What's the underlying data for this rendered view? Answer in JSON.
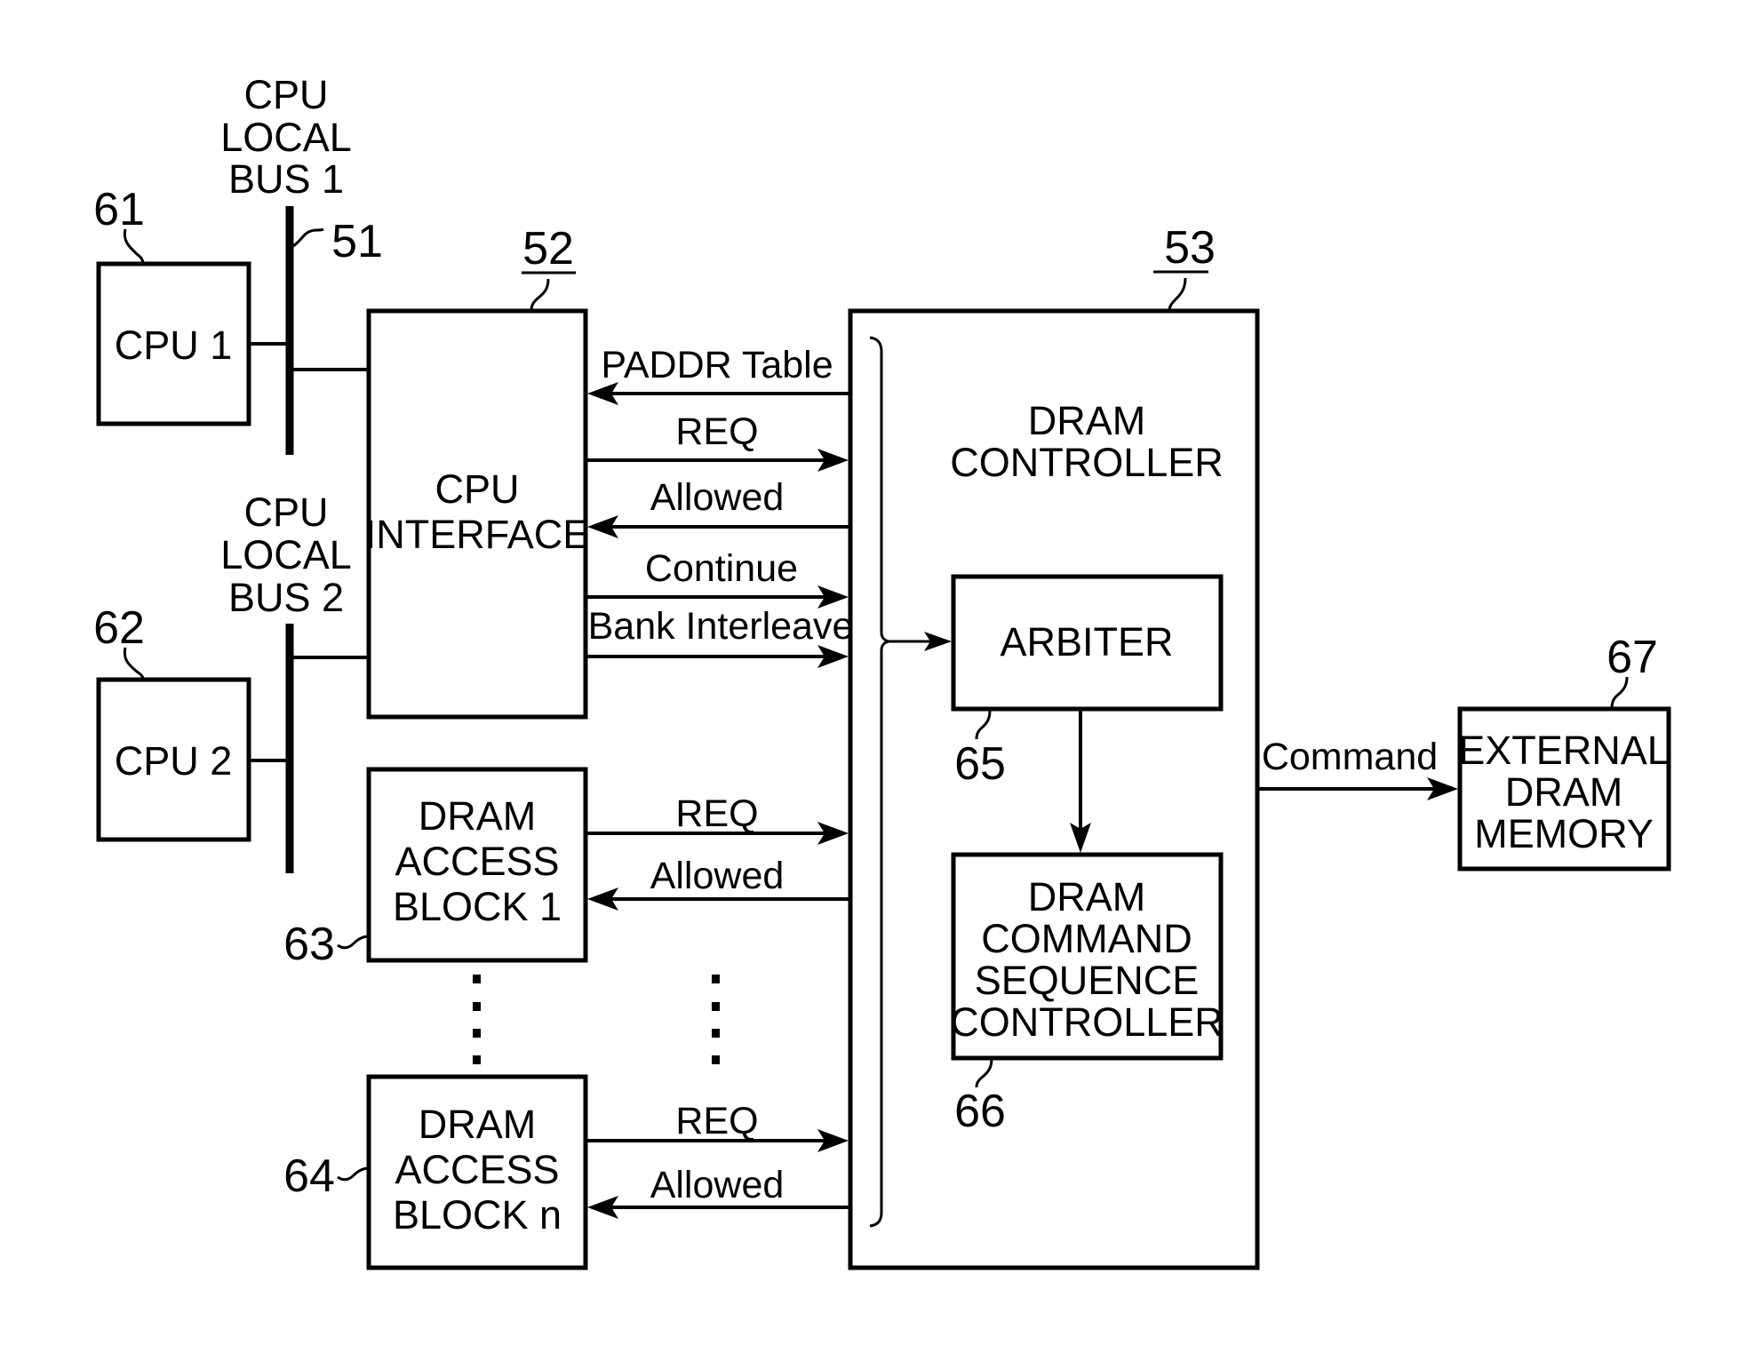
{
  "figure": {
    "cpu_local_bus_1": {
      "ref": "51",
      "label_lines": [
        "CPU",
        "LOCAL",
        "BUS 1"
      ]
    },
    "cpu_local_bus_2": {
      "label_lines": [
        "CPU",
        "LOCAL",
        "BUS 2"
      ]
    },
    "cpu1": {
      "ref": "61",
      "label": "CPU 1"
    },
    "cpu2": {
      "ref": "62",
      "label": "CPU 2"
    },
    "cpu_interface": {
      "ref": "52",
      "label_lines": [
        "CPU",
        "INTERFACE"
      ]
    },
    "dram_access_block_1": {
      "ref": "63",
      "label_lines": [
        "DRAM",
        "ACCESS",
        "BLOCK 1"
      ]
    },
    "dram_access_block_n": {
      "ref": "64",
      "label_lines": [
        "DRAM",
        "ACCESS",
        "BLOCK n"
      ]
    },
    "dram_controller": {
      "ref": "53",
      "label_lines": [
        "DRAM",
        "CONTROLLER"
      ]
    },
    "arbiter": {
      "ref": "65",
      "label": "ARBITER"
    },
    "dram_command_sequence_controller": {
      "ref": "66",
      "label_lines": [
        "DRAM",
        "COMMAND",
        "SEQUENCE",
        "CONTROLLER"
      ]
    },
    "external_dram_memory": {
      "ref": "67",
      "label_lines": [
        "EXTERNAL",
        "DRAM",
        "MEMORY"
      ]
    },
    "signals": {
      "cpu_interface": [
        {
          "label": "PADDR Table",
          "direction": "to-cpu-interface"
        },
        {
          "label": "REQ",
          "direction": "to-dram-controller"
        },
        {
          "label": "Allowed",
          "direction": "to-cpu-interface"
        },
        {
          "label": "Continue",
          "direction": "to-dram-controller"
        },
        {
          "label": "Bank Interleave",
          "direction": "to-dram-controller"
        }
      ],
      "block_1": [
        {
          "label": "REQ",
          "direction": "to-dram-controller"
        },
        {
          "label": "Allowed",
          "direction": "to-access-block"
        }
      ],
      "block_n": [
        {
          "label": "REQ",
          "direction": "to-dram-controller"
        },
        {
          "label": "Allowed",
          "direction": "to-access-block"
        }
      ],
      "command": {
        "label": "Command",
        "direction": "to-external-dram"
      }
    }
  }
}
